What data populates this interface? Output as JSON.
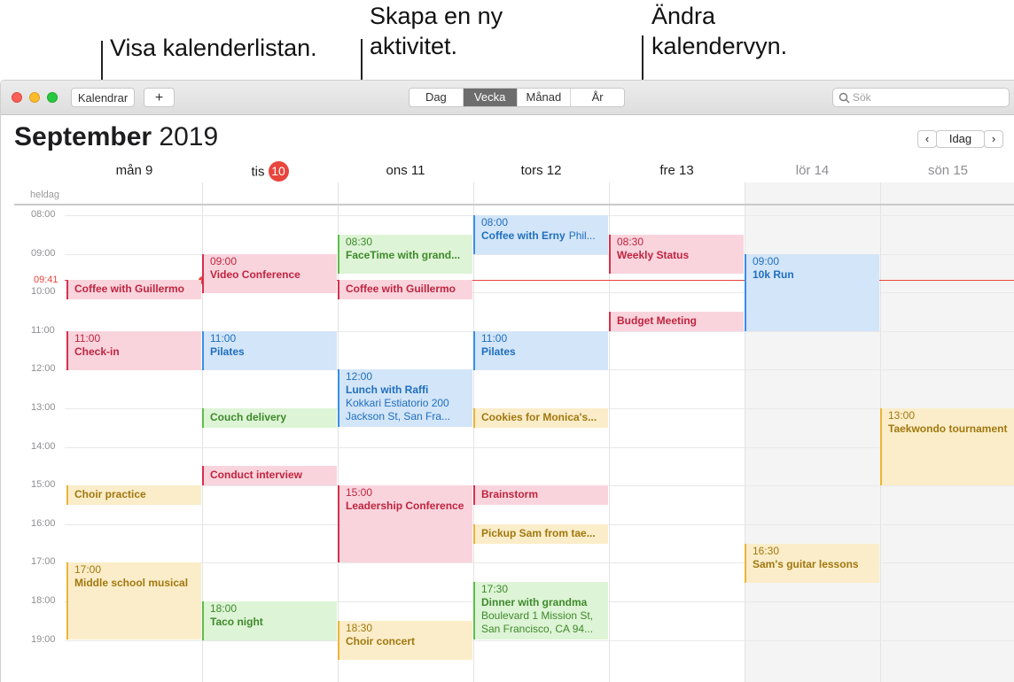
{
  "callouts": {
    "calendar_list": "Visa kalenderlistan.",
    "new_event_line1": "Skapa en ny",
    "new_event_line2": "aktivitet.",
    "change_view_line1": "Ändra",
    "change_view_line2": "kalendervyn."
  },
  "toolbar": {
    "calendars_button": "Kalendrar",
    "add_button": "+",
    "views": [
      "Dag",
      "Vecka",
      "Månad",
      "År"
    ],
    "active_view": "Vecka",
    "search_placeholder": "Sök"
  },
  "header": {
    "month": "September",
    "year": "2019",
    "today_button": "Idag",
    "prev": "‹",
    "next": "›"
  },
  "days": [
    {
      "label": "mån 9"
    },
    {
      "label": "tis",
      "badge": "10"
    },
    {
      "label": "ons 11"
    },
    {
      "label": "tors 12"
    },
    {
      "label": "fre 13"
    },
    {
      "label": "lör 14"
    },
    {
      "label": "sön 15"
    }
  ],
  "all_day_label": "heldag",
  "hours": [
    "08:00",
    "09:00",
    "10:00",
    "11:00",
    "12:00",
    "13:00",
    "14:00",
    "15:00",
    "16:00",
    "17:00",
    "18:00",
    "19:00"
  ],
  "current_time": "09:41",
  "events": [
    {
      "day": 0,
      "start": "09:40",
      "end": "10:10",
      "color": "red",
      "name": "Coffee with Guillermo"
    },
    {
      "day": 0,
      "start": "11:00",
      "end": "12:00",
      "color": "red",
      "time": "11:00",
      "name": "Check-in"
    },
    {
      "day": 0,
      "start": "15:00",
      "end": "15:30",
      "color": "yellow",
      "name": "Choir practice"
    },
    {
      "day": 0,
      "start": "17:00",
      "end": "19:00",
      "color": "yellow",
      "time": "17:00",
      "name": "Middle school musical"
    },
    {
      "day": 1,
      "start": "09:00",
      "end": "10:00",
      "color": "red",
      "time": "09:00",
      "name": "Video Conference"
    },
    {
      "day": 1,
      "start": "11:00",
      "end": "12:00",
      "color": "blue",
      "time": "11:00",
      "name": "Pilates"
    },
    {
      "day": 1,
      "start": "13:00",
      "end": "13:30",
      "color": "green",
      "name": "Couch delivery"
    },
    {
      "day": 1,
      "start": "14:30",
      "end": "15:00",
      "color": "red",
      "name": "Conduct interview"
    },
    {
      "day": 1,
      "start": "18:00",
      "end": "19:00",
      "color": "green",
      "time": "18:00",
      "name": "Taco night"
    },
    {
      "day": 2,
      "start": "08:30",
      "end": "09:30",
      "color": "green",
      "time": "08:30",
      "name": "FaceTime with grand..."
    },
    {
      "day": 2,
      "start": "09:40",
      "end": "10:10",
      "color": "red",
      "name": "Coffee with Guillermo"
    },
    {
      "day": 2,
      "start": "12:00",
      "end": "13:30",
      "color": "blue",
      "time": "12:00",
      "name": "Lunch with Raffi",
      "location": [
        "Kokkari Estiatorio 200",
        "Jackson St, San Fra..."
      ]
    },
    {
      "day": 2,
      "start": "15:00",
      "end": "17:00",
      "color": "red",
      "time": "15:00",
      "name": "Leadership Conference",
      "wrap": true
    },
    {
      "day": 2,
      "start": "18:30",
      "end": "19:30",
      "color": "yellow",
      "time": "18:30",
      "name": "Choir concert"
    },
    {
      "day": 3,
      "start": "08:00",
      "end": "09:00",
      "color": "blue",
      "time": "08:00",
      "name": "Coffee with Erny",
      "inline_location": "Phil..."
    },
    {
      "day": 3,
      "start": "11:00",
      "end": "12:00",
      "color": "blue",
      "time": "11:00",
      "name": "Pilates"
    },
    {
      "day": 3,
      "start": "13:00",
      "end": "13:30",
      "color": "yellow",
      "name": "Cookies for Monica's..."
    },
    {
      "day": 3,
      "start": "15:00",
      "end": "15:30",
      "color": "red",
      "name": "Brainstorm"
    },
    {
      "day": 3,
      "start": "16:00",
      "end": "16:30",
      "color": "yellow",
      "name": "Pickup Sam from tae..."
    },
    {
      "day": 3,
      "start": "17:30",
      "end": "19:00",
      "color": "green",
      "time": "17:30",
      "name": "Dinner with grandma",
      "location": [
        "Boulevard 1 Mission St,",
        "San Francisco, CA  94..."
      ]
    },
    {
      "day": 4,
      "start": "08:30",
      "end": "09:30",
      "color": "red",
      "time": "08:30",
      "name": "Weekly Status"
    },
    {
      "day": 4,
      "start": "10:30",
      "end": "11:00",
      "color": "red",
      "name": "Budget Meeting"
    },
    {
      "day": 5,
      "start": "09:00",
      "end": "11:00",
      "color": "blue",
      "time": "09:00",
      "name": "10k Run"
    },
    {
      "day": 5,
      "start": "16:30",
      "end": "17:30",
      "color": "yellow",
      "time": "16:30",
      "name": "Sam's guitar lessons"
    },
    {
      "day": 6,
      "start": "13:00",
      "end": "15:00",
      "color": "yellow",
      "time": "13:00",
      "name": "Taekwondo tournament",
      "wrap": true
    }
  ]
}
